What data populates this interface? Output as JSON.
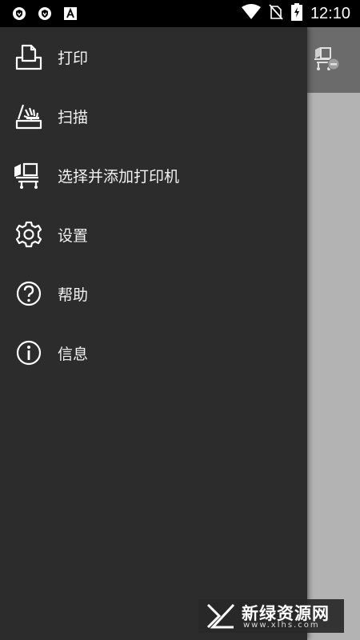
{
  "status_bar": {
    "time": "12:10",
    "notification_icons": [
      "shield-icon",
      "shield-icon",
      "font-a-icon"
    ],
    "system_icons": [
      "wifi-icon",
      "no-sim-icon",
      "battery-charging-icon"
    ]
  },
  "drawer": {
    "items": [
      {
        "label": "打印",
        "icon": "print-icon"
      },
      {
        "label": "扫描",
        "icon": "scan-icon"
      },
      {
        "label": "选择并添加打印机",
        "icon": "add-printer-icon"
      },
      {
        "label": "设置",
        "icon": "gear-icon"
      },
      {
        "label": "帮助",
        "icon": "help-icon"
      },
      {
        "label": "信息",
        "icon": "info-icon"
      }
    ]
  },
  "background_app": {
    "toolbar_icon": "printer-disconnected-icon"
  },
  "watermark": {
    "title": "新绿资源网",
    "subtitle": "www.xlhs.com"
  },
  "colors": {
    "drawer_bg": "#2c2c2c",
    "status_bar_bg": "#000000",
    "toolbar_bg": "#6b6b6b",
    "content_bg": "#b3b3b3"
  }
}
